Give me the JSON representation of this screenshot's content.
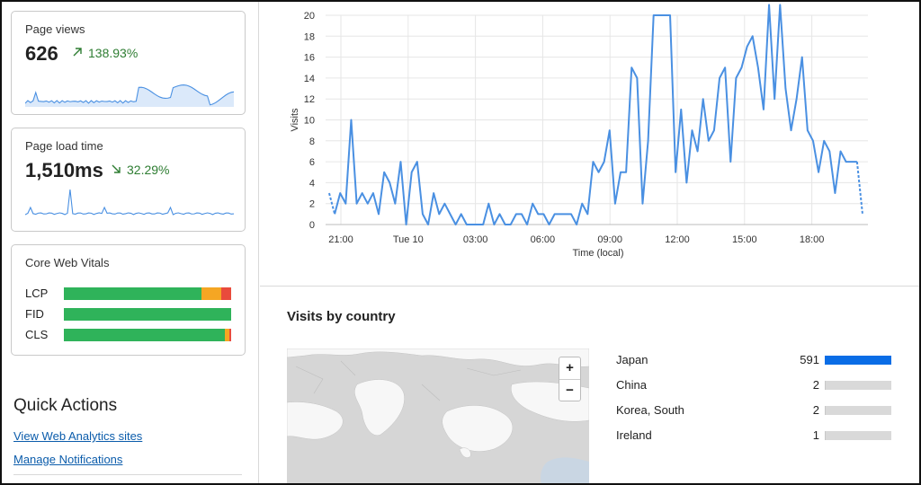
{
  "page_views": {
    "title": "Page views",
    "value": "626",
    "change": "138.93%",
    "direction": "up"
  },
  "page_load_time": {
    "title": "Page load time",
    "value": "1,510ms",
    "change": "32.29%",
    "direction": "down"
  },
  "core_web_vitals": {
    "title": "Core Web Vitals",
    "metrics": [
      {
        "label": "LCP",
        "good": 0.82,
        "needs_improvement": 0.12,
        "poor": 0.06
      },
      {
        "label": "FID",
        "good": 1.0,
        "needs_improvement": 0.0,
        "poor": 0.0
      },
      {
        "label": "CLS",
        "good": 0.96,
        "needs_improvement": 0.03,
        "poor": 0.01
      }
    ],
    "colors": {
      "good": "#2fb35a",
      "needs_improvement": "#f5a623",
      "poor": "#e94b3c"
    }
  },
  "quick_actions": {
    "title": "Quick Actions",
    "links": [
      "View Web Analytics sites",
      "Manage Notifications"
    ]
  },
  "chart_data": {
    "type": "line",
    "ylabel": "Visits",
    "xlabel": "Time (local)",
    "ylim": [
      0,
      20
    ],
    "yticks": [
      0,
      2,
      4,
      6,
      8,
      10,
      12,
      14,
      16,
      18,
      20
    ],
    "xtick_labels": [
      "21:00",
      "Tue 10",
      "03:00",
      "06:00",
      "09:00",
      "12:00",
      "15:00",
      "18:00"
    ],
    "grid": true,
    "color": "#4a90e2",
    "series": [
      {
        "values": [
          3,
          1,
          3,
          2,
          10,
          2,
          3,
          2,
          3,
          1,
          5,
          4,
          2,
          6,
          0,
          5,
          6,
          1,
          0,
          3,
          1,
          2,
          1,
          0,
          1,
          0,
          0,
          0,
          0,
          2,
          0,
          1,
          0,
          0,
          1,
          1,
          0,
          2,
          1,
          1,
          0,
          1,
          1,
          1,
          1,
          0,
          2,
          1,
          6,
          5,
          6,
          9,
          2,
          5,
          5,
          15,
          14,
          2,
          8,
          20,
          20,
          20,
          20,
          5,
          11,
          4,
          9,
          7,
          12,
          8,
          9,
          14,
          15,
          6,
          14,
          15,
          17,
          18,
          15,
          11,
          21,
          12,
          21,
          13,
          9,
          12,
          16,
          9,
          8,
          5,
          8,
          7,
          3,
          7,
          6,
          6,
          6,
          1
        ]
      }
    ]
  },
  "visits_by_country": {
    "title": "Visits by country",
    "zoom_in": "+",
    "zoom_out": "−",
    "countries": [
      {
        "name": "Japan",
        "value": "591",
        "share": 1.0
      },
      {
        "name": "China",
        "value": "2",
        "share": 0.004
      },
      {
        "name": "Korea, South",
        "value": "2",
        "share": 0.004
      },
      {
        "name": "Ireland",
        "value": "1",
        "share": 0.002
      }
    ],
    "bar_color": "#0a6de6"
  }
}
